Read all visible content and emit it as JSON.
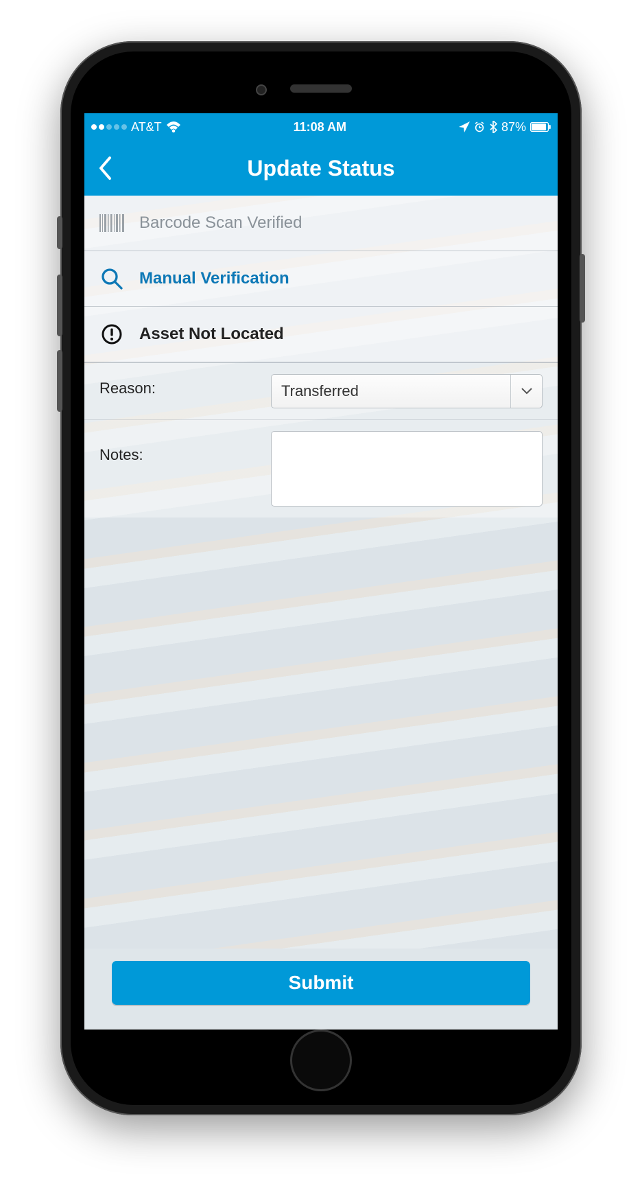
{
  "status_bar": {
    "carrier": "AT&T",
    "time": "11:08 AM",
    "battery_pct": "87%"
  },
  "nav": {
    "title": "Update Status"
  },
  "options": {
    "barcode": {
      "label": "Barcode Scan Verified",
      "icon": "barcode-icon"
    },
    "manual": {
      "label": "Manual Verification",
      "icon": "search-icon"
    },
    "notfound": {
      "label": "Asset Not Located",
      "icon": "alert-icon"
    }
  },
  "form": {
    "reason_label": "Reason:",
    "reason_value": "Transferred",
    "notes_label": "Notes:",
    "notes_value": ""
  },
  "footer": {
    "submit_label": "Submit"
  },
  "colors": {
    "primary": "#0099d8"
  }
}
